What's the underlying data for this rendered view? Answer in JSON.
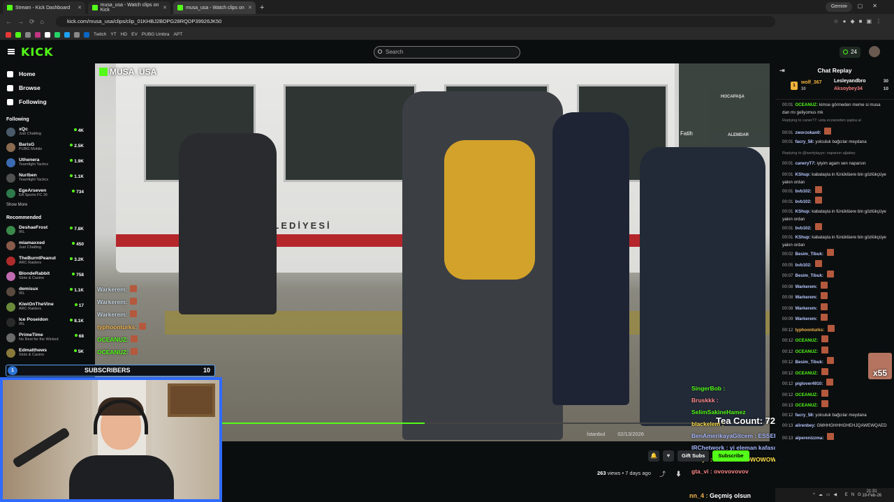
{
  "browser": {
    "tabs": [
      {
        "label": "Stream - Kick Dashboard"
      },
      {
        "label": "musa_usa - Watch clips on Kick"
      },
      {
        "label": "musa_usa - Watch clips on"
      }
    ],
    "new_tab": "+",
    "gemini": "Gemini",
    "url": "kick.com/musa_usa/clips/clip_01KHBJ2BDPG28RQDP39926JK50",
    "bookmarks": [
      "Twitch",
      "YT",
      "HD",
      "EV",
      "PUBG Umbra",
      "APT"
    ]
  },
  "header": {
    "logo": "KICK",
    "search_placeholder": "Search",
    "points": "24"
  },
  "sidebar": {
    "nav": [
      {
        "label": "Home"
      },
      {
        "label": "Browse"
      },
      {
        "label": "Following"
      }
    ],
    "following_title": "Following",
    "following": [
      {
        "name": "xQc",
        "category": "Just Chatting",
        "viewers": "4K",
        "color": "#4a5a6a"
      },
      {
        "name": "BarisG",
        "category": "PUBG Mobile",
        "viewers": "2.5K",
        "color": "#8a6a50"
      },
      {
        "name": "Uthenera",
        "category": "Teamfight Tactics",
        "viewers": "1.9K",
        "color": "#3a6ab0"
      },
      {
        "name": "Nurlben",
        "category": "Teamfight Tactics",
        "viewers": "1.1K",
        "color": "#505050"
      },
      {
        "name": "EgeArseven",
        "category": "EA Sports FC 26",
        "viewers": "734",
        "color": "#2e7a4a"
      }
    ],
    "show_more": "Show More",
    "recommended_title": "Recommended",
    "recommended": [
      {
        "name": "DeshaeFrost",
        "category": "IRL",
        "viewers": "7.8K",
        "color": "#3a8a4a"
      },
      {
        "name": "miamaxxed",
        "category": "Just Chatting",
        "viewers": "450",
        "color": "#8a5a4a"
      },
      {
        "name": "TheBurntPeanut",
        "category": "ARC Raiders",
        "viewers": "3.2K",
        "color": "#b02a2a"
      },
      {
        "name": "BlondeRabbit",
        "category": "Slots & Casino",
        "viewers": "758",
        "color": "#c06ab0"
      },
      {
        "name": "demisux",
        "category": "IRL",
        "viewers": "1.1K",
        "color": "#5a4a40"
      },
      {
        "name": "KiwiOnTheVine",
        "category": "ARC Raiders",
        "viewers": "17",
        "color": "#6a8a3a"
      },
      {
        "name": "Ice Poseidon",
        "category": "IRL",
        "viewers": "8.1K",
        "color": "#2a2a2a"
      },
      {
        "name": "PrimeTime",
        "category": "No Rest for the Wicked",
        "viewers": "68",
        "color": "#6a6a6a"
      },
      {
        "name": "Edmatthews",
        "category": "Slots & Casino",
        "viewers": "5K",
        "color": "#8a7a3a"
      }
    ]
  },
  "video": {
    "brand": "MUSA_USA",
    "tram_text": "ŞEHİR BELEDİYESİ",
    "map_labels": [
      "HOCAPAŞA",
      "ALEMDAR",
      "Fatih"
    ],
    "overlay_left": [
      {
        "user": "Warkerem:",
        "cls": ""
      },
      {
        "user": "Warkerem:",
        "cls": ""
      },
      {
        "user": "Warkerem:",
        "cls": ""
      },
      {
        "user": "typhoonturks:",
        "cls": "o"
      },
      {
        "user": "OCEANUZ:",
        "cls": "g"
      },
      {
        "user": "OCEANUZ:",
        "cls": "g"
      }
    ],
    "subs_count_left": "1",
    "subs_label": "SUBSCRIBERS",
    "subs_count_right": "10",
    "tea_count": "Tea Count: 72",
    "progress": 0.37,
    "location": "İstanbul",
    "date": "02/13/2026",
    "overlay_right": [
      {
        "text": "SingerBob :",
        "cls": "ocr1"
      },
      {
        "text": "Bruskkk :",
        "cls": "ocr2"
      },
      {
        "text": "SelimSakineHamez",
        "cls": "ocr1"
      },
      {
        "text": "blackelem :",
        "cls": "ocr4"
      },
      {
        "text": "BenAmerikayaGitcem : ESSEEEK",
        "cls": "ocr3"
      },
      {
        "text": "IRChetwork : yi eleman kafasını karıştırd",
        "cls": "ocr3"
      },
      {
        "text": "dehye : WWOWOWOWOWOWO",
        "cls": "ocr4"
      },
      {
        "text": "gta_vi : ovovovovov",
        "cls": "ocr2"
      }
    ],
    "bottom_user": "nn_4 :",
    "bottom_text": "Geçmiş olsun"
  },
  "actions": {
    "gift_subs": "Gift Subs",
    "subscribe": "Subscribe",
    "views": "263",
    "views_label": "views",
    "age": "7 days ago"
  },
  "chat": {
    "title": "Chat Replay",
    "pinned": {
      "rank1_name": "wolf_367",
      "rank1_value": "30",
      "rank2_name": "Lesleyandbro",
      "rank2_value": "30",
      "rank3_name": "Aksoybey34",
      "rank3_value": "10"
    },
    "messages": [
      {
        "time": "00:01",
        "user": "OCEANUZ:",
        "color": "#53fc18",
        "text": "kimse görmeden meme si musa dan mı geliyomus mk"
      },
      {
        "time": "",
        "user": "",
        "color": "#888",
        "text": "Replying to caner77: usta eczaneden şapka al"
      },
      {
        "time": "00:01",
        "user": "zworzokan0:",
        "color": "#b8c8ff",
        "text": ""
      },
      {
        "time": "00:01",
        "user": "facry_58:",
        "color": "#b8c8ff",
        "text": "yolculuk bağcılar meydana"
      },
      {
        "time": "",
        "user": "",
        "color": "#888",
        "text": "Replying to @wertylayyo: naparsın ağabey"
      },
      {
        "time": "00:01",
        "user": "caneryT7:",
        "color": "#b8c8ff",
        "text": "iyiyim agam sen naparsın"
      },
      {
        "time": "00:01",
        "user": "KShup:",
        "color": "#b8c8ff",
        "text": "kabataşta in fünüklüere bin gözlükçüye yakın ordan"
      },
      {
        "time": "00:01",
        "user": "bvb102:",
        "color": "#b8c8ff",
        "text": ""
      },
      {
        "time": "00:01",
        "user": "bvb102:",
        "color": "#b8c8ff",
        "text": ""
      },
      {
        "time": "00:01",
        "user": "KShup:",
        "color": "#b8c8ff",
        "text": "kabataşta in fünüklüere bin gözlükçüye yakın ordan"
      },
      {
        "time": "00:01",
        "user": "bvb102:",
        "color": "#b8c8ff",
        "text": ""
      },
      {
        "time": "00:01",
        "user": "KShup:",
        "color": "#b8c8ff",
        "text": "kabataşta in fünüklüere bin gözlükçüye yakın ordan"
      },
      {
        "time": "00:02",
        "user": "Besim_Tibuk:",
        "color": "#b8c8ff",
        "text": ""
      },
      {
        "time": "00:05",
        "user": "bvb102:",
        "color": "#b8c8ff",
        "text": ""
      },
      {
        "time": "00:07",
        "user": "Besim_Tibuk:",
        "color": "#b8c8ff",
        "text": ""
      },
      {
        "time": "00:08",
        "user": "Warkerem:",
        "color": "#b8c8ff",
        "text": ""
      },
      {
        "time": "00:08",
        "user": "Warkerem:",
        "color": "#b8c8ff",
        "text": ""
      },
      {
        "time": "00:08",
        "user": "Warkerem:",
        "color": "#b8c8ff",
        "text": ""
      },
      {
        "time": "00:09",
        "user": "Warkerem:",
        "color": "#b8c8ff",
        "text": ""
      },
      {
        "time": "00:12",
        "user": "typhoonturks:",
        "color": "#f3b44e",
        "text": ""
      },
      {
        "time": "00:12",
        "user": "OCEANUZ:",
        "color": "#53fc18",
        "text": ""
      },
      {
        "time": "00:12",
        "user": "OCEANUZ:",
        "color": "#53fc18",
        "text": ""
      },
      {
        "time": "00:12",
        "user": "Besim_Tibuk:",
        "color": "#b8c8ff",
        "text": ""
      },
      {
        "time": "00:12",
        "user": "OCEANUZ:",
        "color": "#53fc18",
        "text": ""
      },
      {
        "time": "00:12",
        "user": "piglover4910:",
        "color": "#b8c8ff",
        "text": ""
      },
      {
        "time": "00:12",
        "user": "OCEANUZ:",
        "color": "#53fc18",
        "text": ""
      },
      {
        "time": "00:13",
        "user": "OCEANUZ:",
        "color": "#53fc18",
        "text": ""
      },
      {
        "time": "00:12",
        "user": "facry_58:",
        "color": "#b8c8ff",
        "text": "yolculuk bağcılar meydana"
      },
      {
        "time": "00:13",
        "user": "alirenbey:",
        "color": "#b8c8ff",
        "text": "GMHHGHHHGHEHJQAWEWQAED"
      },
      {
        "time": "00:13",
        "user": "alperenizzma:",
        "color": "#b8c8ff",
        "text": ""
      }
    ],
    "side_badge": "x55"
  },
  "taskbar": {
    "lang": "ENG",
    "time": "21:31",
    "date": "19-Feb-26"
  }
}
